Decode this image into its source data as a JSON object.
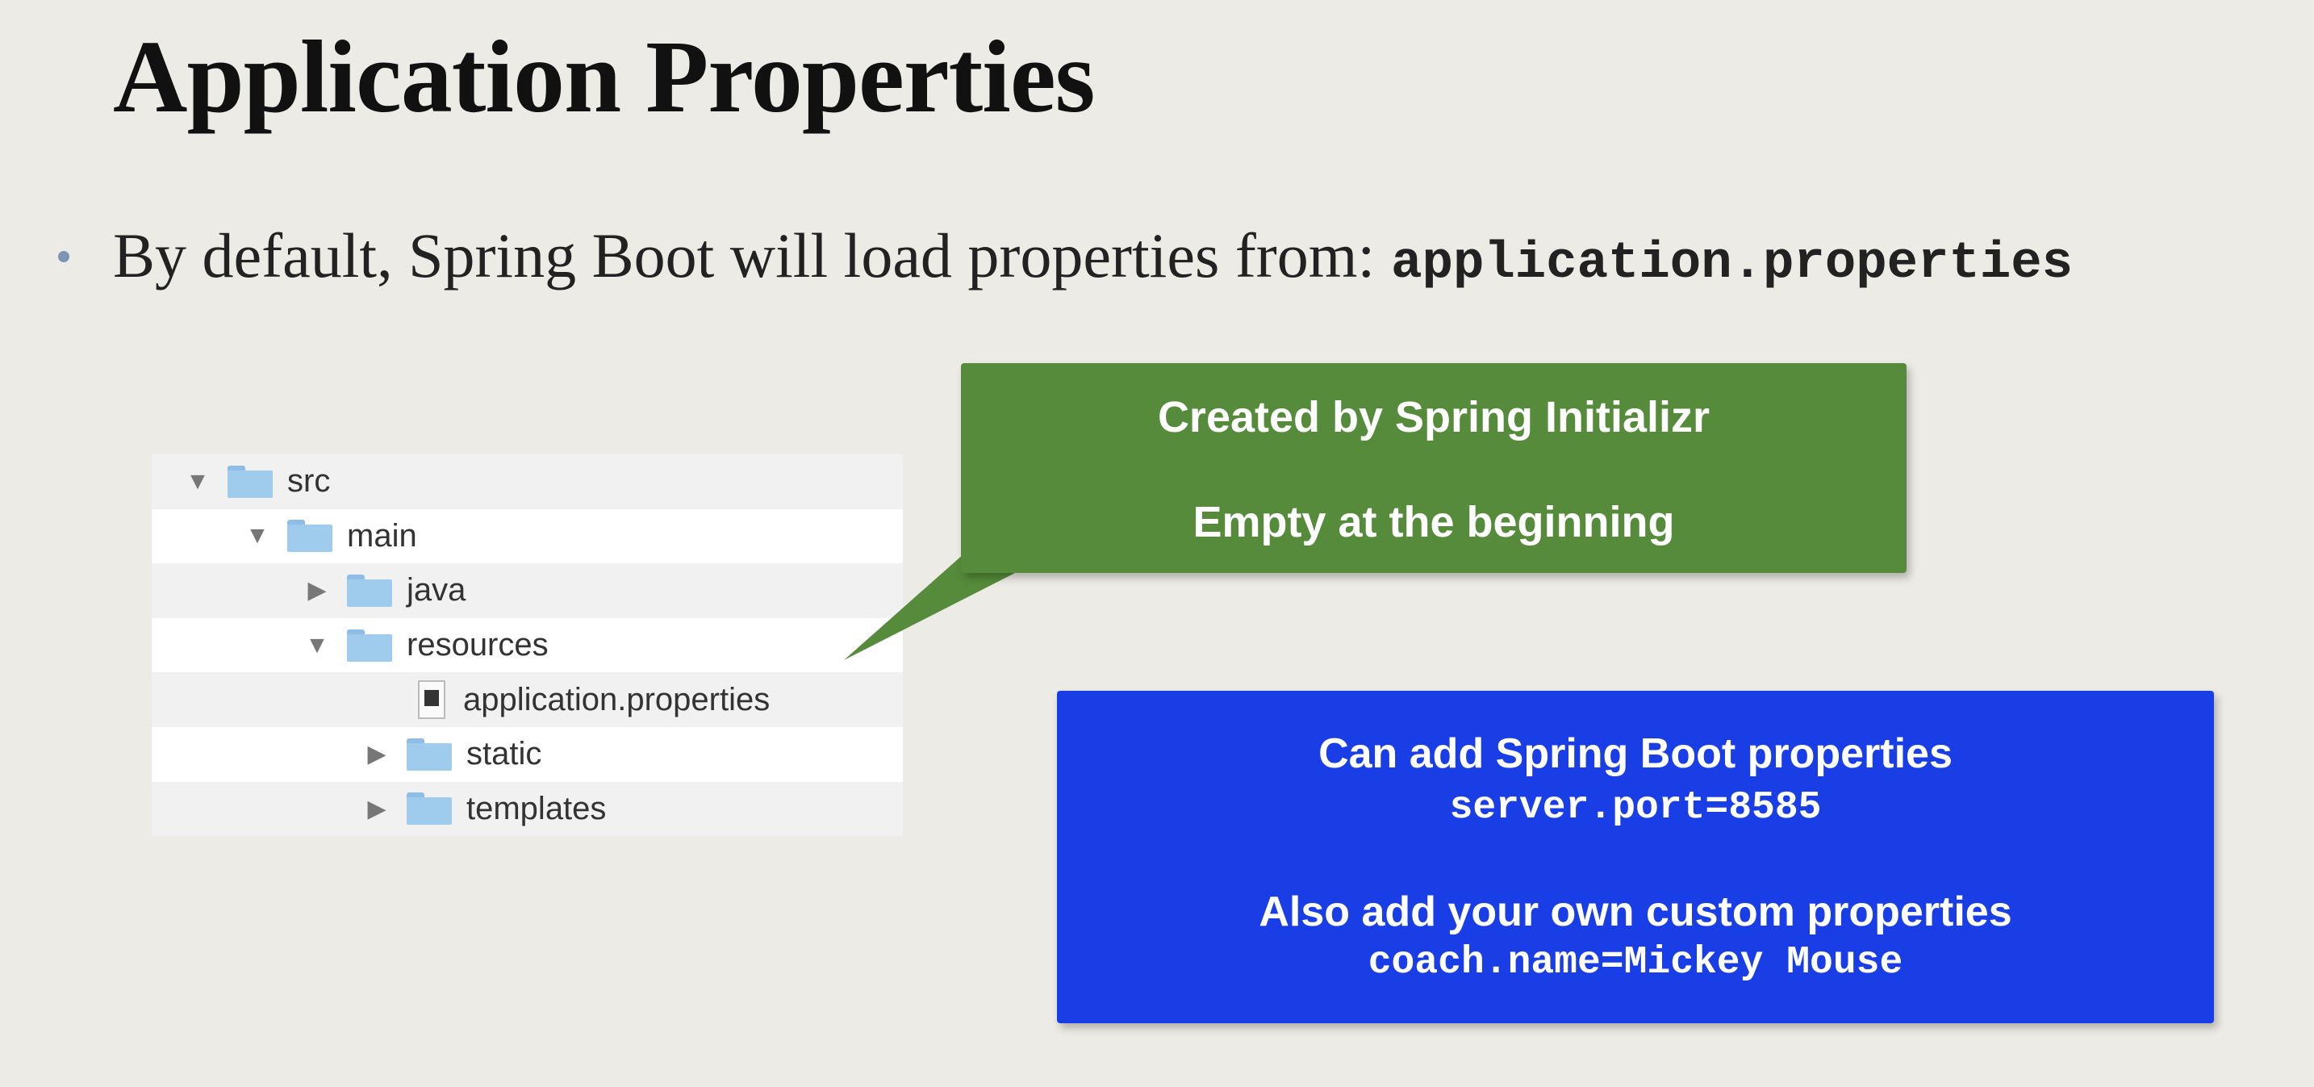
{
  "slide": {
    "title": "Application Properties",
    "bullet_text": "By default, Spring Boot will load properties from:",
    "bullet_code": "application.properties"
  },
  "tree": {
    "items": [
      {
        "label": "src",
        "type": "folder",
        "state": "expanded",
        "depth": 0
      },
      {
        "label": "main",
        "type": "folder",
        "state": "expanded",
        "depth": 1
      },
      {
        "label": "java",
        "type": "folder",
        "state": "collapsed",
        "depth": 2
      },
      {
        "label": "resources",
        "type": "folder",
        "state": "expanded",
        "depth": 2
      },
      {
        "label": "application.properties",
        "type": "file",
        "state": "none",
        "depth": 3
      },
      {
        "label": "static",
        "type": "folder",
        "state": "collapsed",
        "depth": 3
      },
      {
        "label": "templates",
        "type": "folder",
        "state": "collapsed",
        "depth": 3
      }
    ]
  },
  "green_callout": {
    "line1": "Created by Spring Initializr",
    "line2": "Empty at the beginning",
    "color": "#558b3a"
  },
  "blue_box": {
    "line1": "Can add Spring Boot properties",
    "code1": "server.port=8585",
    "line2": "Also add your own custom properties",
    "code2": "coach.name=Mickey Mouse",
    "color": "#1a3ee6"
  }
}
